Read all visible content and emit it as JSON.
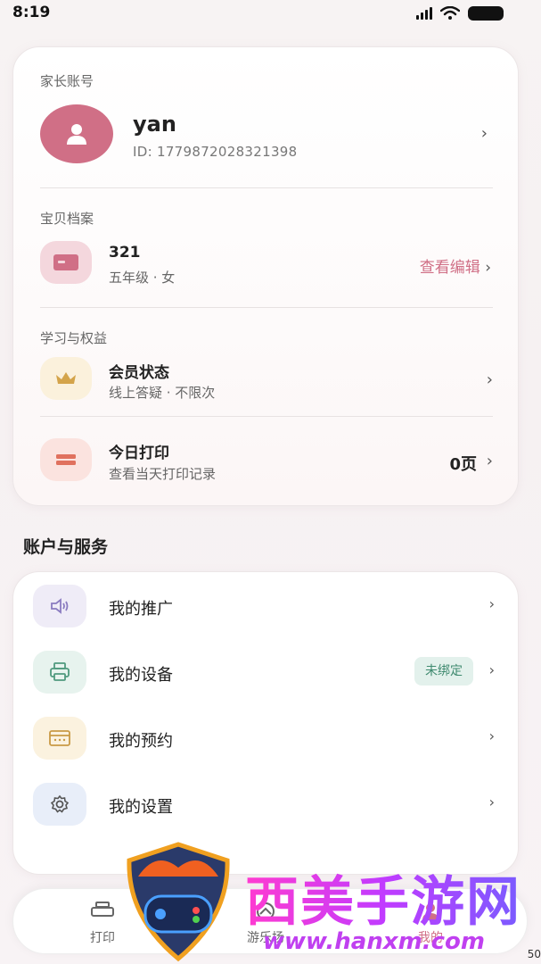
{
  "status_bar": {
    "time": "8:19"
  },
  "parent_account": {
    "label": "家长账号",
    "name": "yan",
    "id": "ID: 1779872028321398"
  },
  "baby_profile": {
    "label": "宝贝档案",
    "name": "321",
    "detail": "五年级 · 女",
    "edit_link": "查看编辑"
  },
  "learning": {
    "label": "学习与权益",
    "membership": {
      "title": "会员状态",
      "sub": "线上答疑 · 不限次"
    },
    "print_today": {
      "title": "今日打印",
      "sub": "查看当天打印记录",
      "count": "0页"
    }
  },
  "services": {
    "header": "账户与服务",
    "items": [
      {
        "label": "我的推广",
        "icon": "speaker-icon",
        "color": "#efecf7"
      },
      {
        "label": "我的设备",
        "icon": "printer-icon",
        "color": "#e7f3ee",
        "badge": "未绑定"
      },
      {
        "label": "我的预约",
        "icon": "calendar-icon",
        "color": "#fbf2df"
      },
      {
        "label": "我的设置",
        "icon": "gear-icon",
        "color": "#e8eef9"
      }
    ]
  },
  "tab_bar": {
    "tabs": [
      {
        "label": "打印",
        "icon": "printer-icon"
      },
      {
        "label": "游乐场",
        "icon": "playground-icon"
      },
      {
        "label": "我的",
        "icon": "user-icon",
        "active": true
      }
    ]
  },
  "watermark": {
    "text": "西美手游网",
    "url": "www.hanxm.com"
  },
  "corner_text": "50",
  "colors": {
    "accent": "#d06f86",
    "badge_text": "#3f8a6f"
  }
}
